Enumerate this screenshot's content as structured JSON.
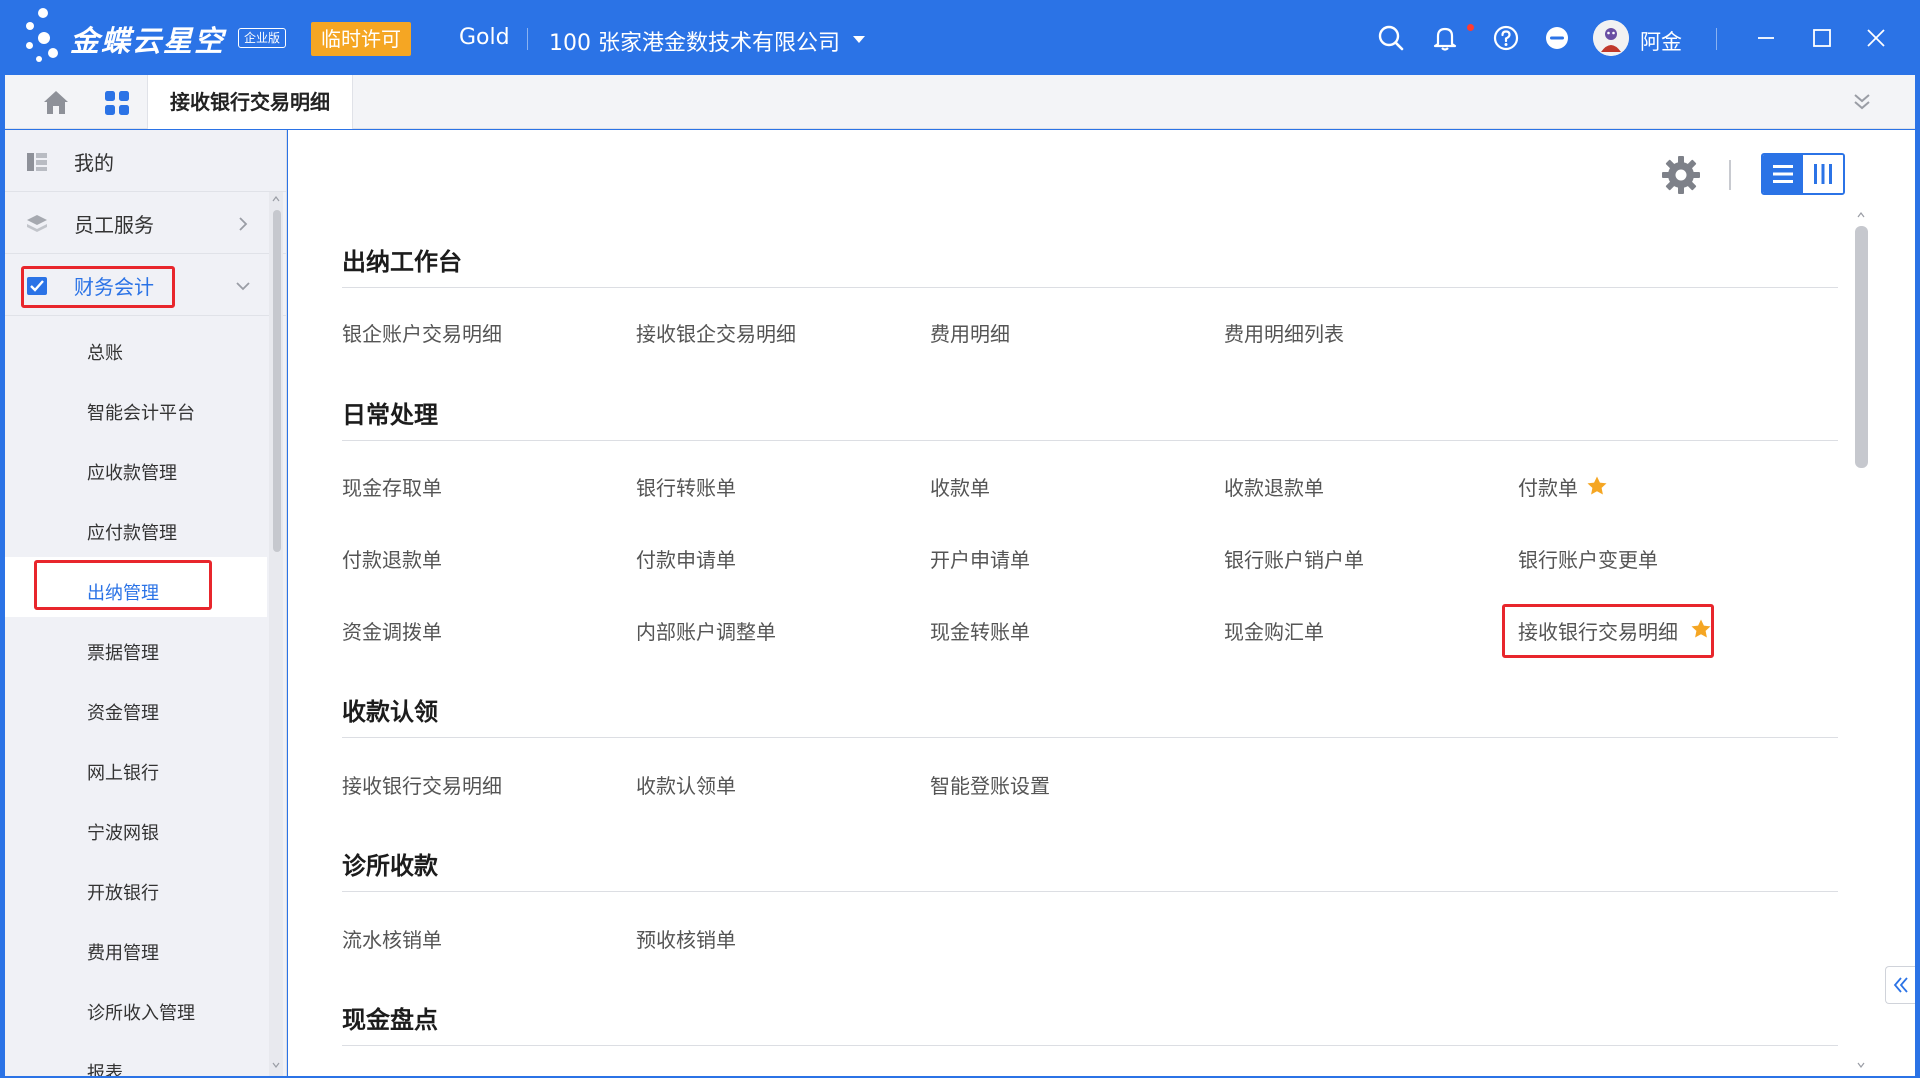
{
  "topbar": {
    "brand": "金蝶云星空",
    "brand_badge": "企业版",
    "license_label": "临时许可",
    "tenant": "Gold",
    "org": "100  张家港金数技术有限公司",
    "user_name": "阿金"
  },
  "tabbar": {
    "active_tab": "接收银行交易明细"
  },
  "sidebar": {
    "top_items": [
      {
        "label": "我的",
        "icon": "dashboard-icon"
      },
      {
        "label": "员工服务",
        "icon": "layers-icon"
      },
      {
        "label": "财务会计",
        "icon": "checkbox-icon"
      }
    ],
    "sub_items": [
      {
        "label": "总账"
      },
      {
        "label": "智能会计平台"
      },
      {
        "label": "应收款管理"
      },
      {
        "label": "应付款管理"
      },
      {
        "label": "出纳管理",
        "active": true
      },
      {
        "label": "票据管理"
      },
      {
        "label": "资金管理"
      },
      {
        "label": "网上银行"
      },
      {
        "label": "宁波网银"
      },
      {
        "label": "开放银行"
      },
      {
        "label": "费用管理"
      },
      {
        "label": "诊所收入管理"
      },
      {
        "label": "报表"
      }
    ]
  },
  "main": {
    "sections": [
      {
        "title": "出纳工作台",
        "items": [
          {
            "label": "银企账户交易明细"
          },
          {
            "label": "接收银企交易明细"
          },
          {
            "label": "费用明细"
          },
          {
            "label": "费用明细列表"
          }
        ]
      },
      {
        "title": "日常处理",
        "items": [
          {
            "label": "现金存取单"
          },
          {
            "label": "银行转账单"
          },
          {
            "label": "收款单"
          },
          {
            "label": "收款退款单"
          },
          {
            "label": "付款单",
            "starred": true
          },
          {
            "label": "付款退款单"
          },
          {
            "label": "付款申请单"
          },
          {
            "label": "开户申请单"
          },
          {
            "label": "银行账户销户单"
          },
          {
            "label": "银行账户变更单"
          },
          {
            "label": "资金调拨单"
          },
          {
            "label": "内部账户调整单"
          },
          {
            "label": "现金转账单"
          },
          {
            "label": "现金购汇单"
          },
          {
            "label": "接收银行交易明细",
            "starred": true
          }
        ]
      },
      {
        "title": "收款认领",
        "items": [
          {
            "label": "接收银行交易明细"
          },
          {
            "label": "收款认领单"
          },
          {
            "label": "智能登账设置"
          }
        ]
      },
      {
        "title": "诊所收款",
        "items": [
          {
            "label": "流水核销单"
          },
          {
            "label": "预收核销单"
          }
        ]
      },
      {
        "title": "现金盘点",
        "items": []
      }
    ]
  },
  "colors": {
    "brand_blue": "#2b73e6",
    "license_orange": "#f5a623",
    "star_orange": "#f5a623",
    "annotation_red": "#e8262c"
  }
}
